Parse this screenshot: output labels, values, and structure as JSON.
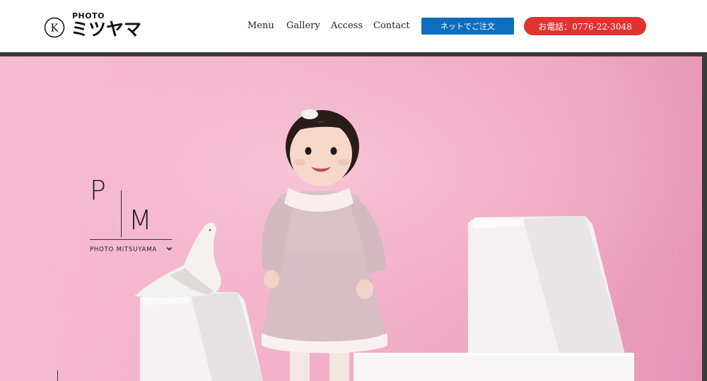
{
  "header": {
    "logo_small": "PHOTO",
    "logo_main": "ミツヤマ",
    "logo_mark_letter": "K",
    "nav": [
      {
        "label": "Menu"
      },
      {
        "label": "Gallery"
      },
      {
        "label": "Access"
      },
      {
        "label": "Contact"
      }
    ],
    "order_button": "ネットでご注文",
    "phone_button": "お電話：0776-22-3048"
  },
  "hero": {
    "logo_p": "P",
    "logo_m": "M",
    "logo_text": "PHOTO MITSUYAMA"
  },
  "colors": {
    "order_blue": "#0e6dbf",
    "phone_red": "#e23232",
    "hero_pink": "#f3b3cb"
  }
}
